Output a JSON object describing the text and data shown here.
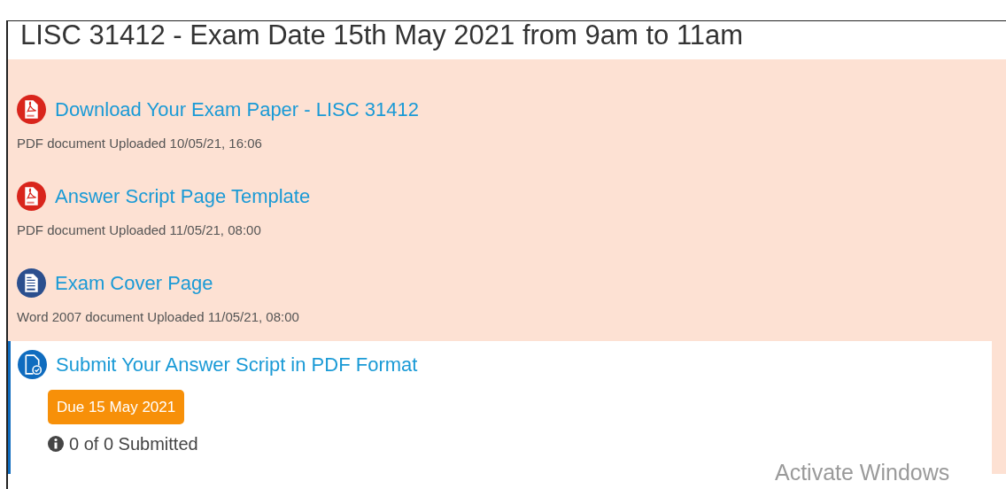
{
  "title": "LISC 31412 - Exam Date 15th May 2021 from 9am to 11am",
  "resources": [
    {
      "kind": "pdf",
      "title": "Download Your Exam Paper - LISC 31412",
      "details": "PDF document Uploaded 10/05/21, 16:06"
    },
    {
      "kind": "pdf",
      "title": "Answer Script Page Template",
      "details": "PDF document Uploaded 11/05/21, 08:00"
    },
    {
      "kind": "word",
      "title": "Exam Cover Page",
      "details": "Word 2007 document Uploaded 11/05/21, 08:00"
    }
  ],
  "assignment": {
    "title": "Submit Your Answer Script in PDF Format",
    "due": "Due 15 May 2021",
    "submissions": "0 of 0 Submitted"
  },
  "os_overlay": {
    "text": "Activate Windows"
  }
}
